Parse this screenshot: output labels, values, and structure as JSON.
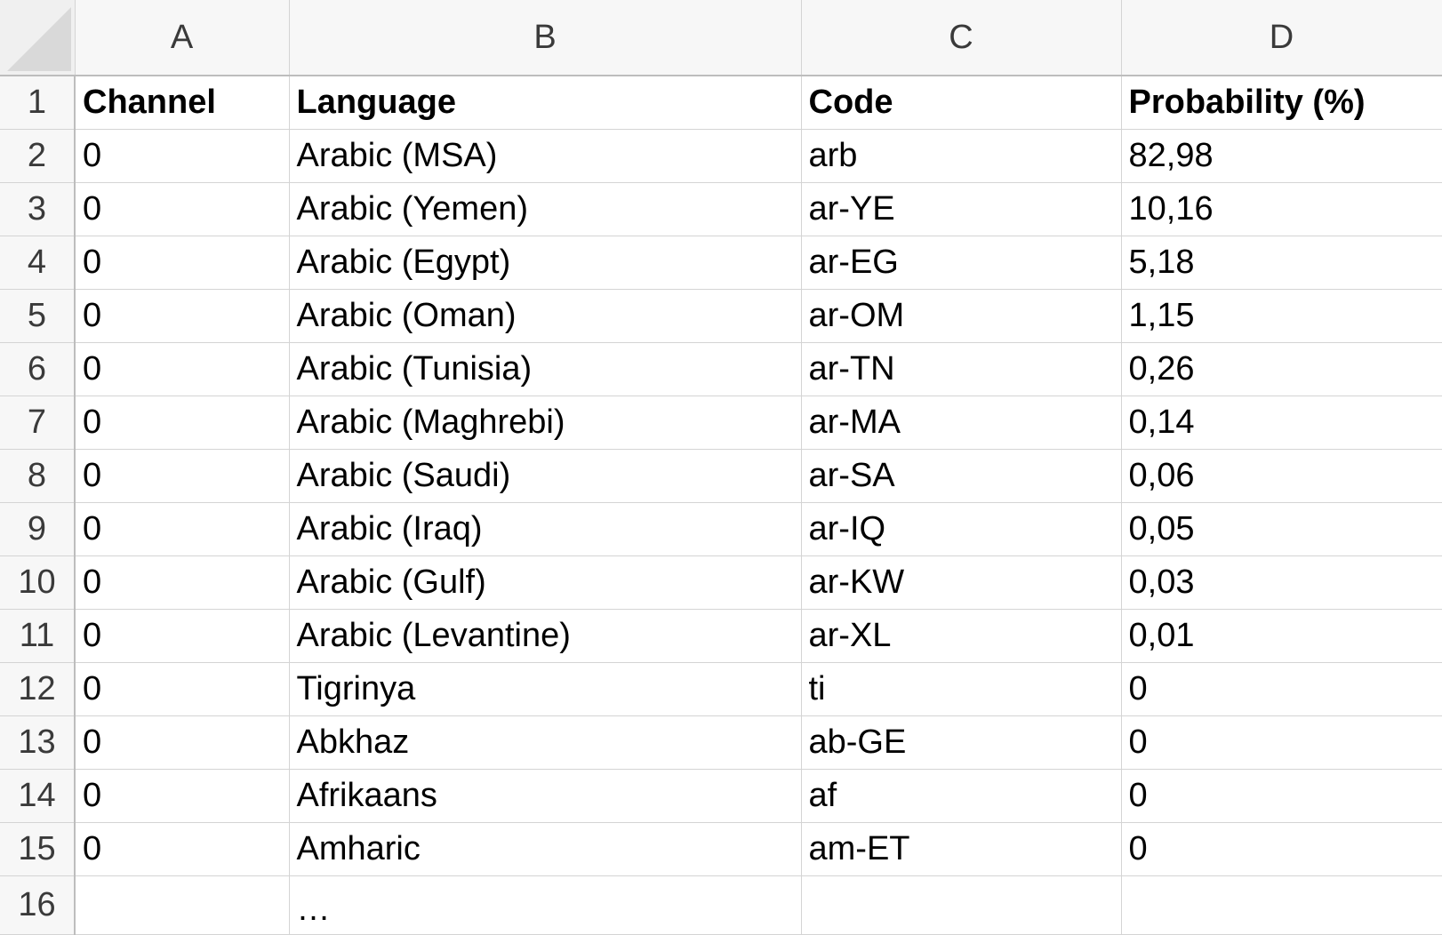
{
  "columns": [
    "A",
    "B",
    "C",
    "D"
  ],
  "header": {
    "row_number": "1",
    "channel": "Channel",
    "language": "Language",
    "code": "Code",
    "probability": "Probability (%)"
  },
  "rows": [
    {
      "row": "2",
      "channel": "0",
      "language": "Arabic (MSA)",
      "code": "arb",
      "probability": "82,98"
    },
    {
      "row": "3",
      "channel": "0",
      "language": "Arabic (Yemen)",
      "code": "ar-YE",
      "probability": "10,16"
    },
    {
      "row": "4",
      "channel": "0",
      "language": "Arabic (Egypt)",
      "code": "ar-EG",
      "probability": "5,18"
    },
    {
      "row": "5",
      "channel": "0",
      "language": "Arabic (Oman)",
      "code": "ar-OM",
      "probability": "1,15"
    },
    {
      "row": "6",
      "channel": "0",
      "language": "Arabic (Tunisia)",
      "code": "ar-TN",
      "probability": "0,26"
    },
    {
      "row": "7",
      "channel": "0",
      "language": "Arabic (Maghrebi)",
      "code": "ar-MA",
      "probability": "0,14"
    },
    {
      "row": "8",
      "channel": "0",
      "language": "Arabic (Saudi)",
      "code": "ar-SA",
      "probability": "0,06"
    },
    {
      "row": "9",
      "channel": "0",
      "language": "Arabic (Iraq)",
      "code": "ar-IQ",
      "probability": "0,05"
    },
    {
      "row": "10",
      "channel": "0",
      "language": "Arabic (Gulf)",
      "code": "ar-KW",
      "probability": "0,03"
    },
    {
      "row": "11",
      "channel": "0",
      "language": "Arabic (Levantine)",
      "code": "ar-XL",
      "probability": "0,01"
    },
    {
      "row": "12",
      "channel": "0",
      "language": "Tigrinya",
      "code": "ti",
      "probability": "0"
    },
    {
      "row": "13",
      "channel": "0",
      "language": "Abkhaz",
      "code": "ab-GE",
      "probability": "0"
    },
    {
      "row": "14",
      "channel": "0",
      "language": "Afrikaans",
      "code": "af",
      "probability": "0"
    },
    {
      "row": "15",
      "channel": "0",
      "language": "Amharic",
      "code": "am-ET",
      "probability": "0"
    }
  ],
  "trailing_row": {
    "row": "16",
    "channel": "",
    "language": "…",
    "code": "",
    "probability": ""
  }
}
